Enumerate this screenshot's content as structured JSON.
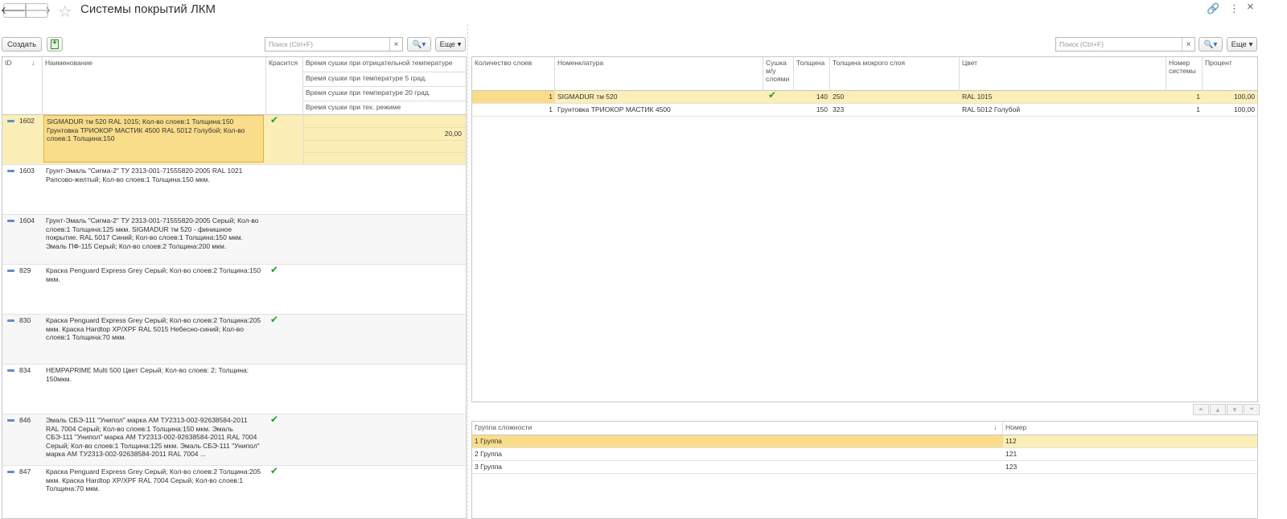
{
  "window": {
    "title": "Системы покрытий ЛКМ"
  },
  "toolbar": {
    "create_label": "Создать",
    "search_placeholder": "Поиск (Ctrl+F)",
    "clear_label": "×",
    "more_label": "Еще ▾",
    "search_btn_label": "🔍▾"
  },
  "main_table": {
    "headers": {
      "id": "ID",
      "sort": "↓",
      "name": "Наименование",
      "paint": "Красится",
      "dry_neg": "Время сушки при отрицательной температуре",
      "dry_5": "Время сушки при температуре 5 град.",
      "dry_20": "Время сушки при температуре 20 град.",
      "dry_tech": "Время сушки при тех. режиме"
    },
    "rows": [
      {
        "id": "1602",
        "name": "SIGMADUR тм 520 RAL 1015; Кол-во слоев:1 Толщина:150 Грунтовка ТРИОКОР МАСТИК 4500 RAL 5012 Голубой; Кол-во слоев:1 Толщина:150",
        "paint": "✔",
        "dry_5": "20,00"
      },
      {
        "id": "1603",
        "name": "Грунт-Эмаль \"Сигма-2\" ТУ 2313-001-71555820-2005 RAL 1021 Рапсово-желтый; Кол-во слоев:1 Толщина:150 мкм.",
        "paint": ""
      },
      {
        "id": "1604",
        "name": "Грунт-Эмаль \"Сигма-2\" ТУ 2313-001-71555820-2005 Серый; Кол-во слоев:1 Толщина:125 мкм. SIGMADUR тм 520 - финишное покрытие. RAL 5017 Синий; Кол-во слоев:1 Толщина:150 мкм. Эмаль ПФ-115 Серый; Кол-во слоев:2 Толщина:200 мкм.",
        "paint": ""
      },
      {
        "id": "829",
        "name": "Краска Penguard Express Grey Серый; Кол-во слоев:2 Толщина:150 мкм.",
        "paint": "✔"
      },
      {
        "id": "830",
        "name": "Краска Penguard Express Grey Серый; Кол-во слоев:2 Толщина:205 мкм. Краска Hardtop XP/XPF RAL 5015 Небесно-синий; Кол-во слоев:1 Толщина:70 мкм.",
        "paint": "✔"
      },
      {
        "id": "834",
        "name": "HEMPAPRIME Multi 500 Цвет Серый; Кол-во слоев: 2; Толщина: 150мкм.",
        "paint": ""
      },
      {
        "id": "846",
        "name": "Эмаль СБЭ-111 \"Унипол\" марка АМ ТУ2313-002-92638584-2011 RAL 7004 Серый; Кол-во слоев:1 Толщина:150 мкм. Эмаль СБЭ-111 \"Унипол\" марка АМ ТУ2313-002-92638584-2011 RAL 7004 Серый; Кол-во слоев:1 Толщина:125 мкм. Эмаль СБЭ-111 \"Унипол\" марка АМ ТУ2313-002-92638584-2011 RAL 7004 ...",
        "paint": "✔"
      },
      {
        "id": "847",
        "name": "Краска Penguard Express Grey Серый; Кол-во слоев:2 Толщина:205 мкм. Краска Hardtop XP/XPF RAL 7004 Серый; Кол-во слоев:1 Толщина:70 мкм.",
        "paint": "✔"
      }
    ]
  },
  "layers_table": {
    "headers": {
      "count": "Количество слоев",
      "nomen": "Номенклатура",
      "dry": "Сушка м/у слоями",
      "thick": "Толщина",
      "wet": "Толщина мокрого слоя",
      "color": "Цвет",
      "sysnum": "Номер системы",
      "pct": "Процент"
    },
    "rows": [
      {
        "count": "1",
        "nomen": "SIGMADUR тм 520",
        "dry": "✔",
        "thick": "140",
        "wet": "250",
        "color": "RAL 1015",
        "sysnum": "1",
        "pct": "100,00"
      },
      {
        "count": "1",
        "nomen": "Грунтовка ТРИОКОР МАСТИК 4500",
        "dry": "",
        "thick": "150",
        "wet": "323",
        "color": "RAL 5012 Голубой",
        "sysnum": "1",
        "pct": "100,00"
      }
    ]
  },
  "groups_table": {
    "headers": {
      "group": "Группа сложности",
      "sort": "↓",
      "number": "Номер"
    },
    "rows": [
      {
        "group": "1 Группа",
        "number": "112"
      },
      {
        "group": "2 Группа",
        "number": "121"
      },
      {
        "group": "3 Группа",
        "number": "123"
      }
    ]
  }
}
